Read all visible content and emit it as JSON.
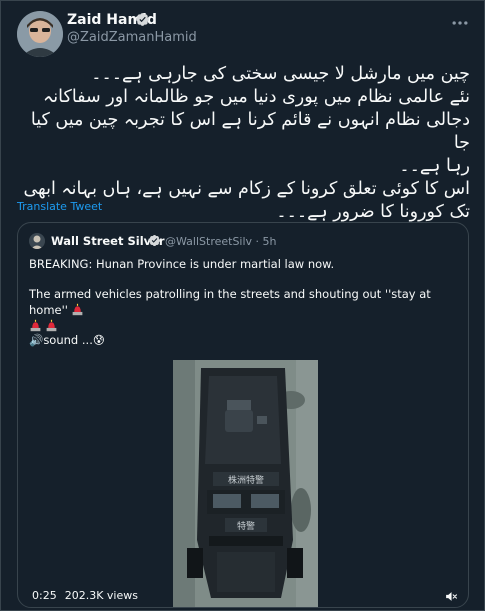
{
  "tweet": {
    "author_name": "Zaid Hamid",
    "author_handle": "@ZaidZamanHamid",
    "more_icon": "more-horizontal-icon",
    "text_lines": [
      "چین میں مارشل لا جیسی سختی کی جارہی ہے۔۔۔",
      "نئے عالمی نظام میں پوری دنیا میں جو ظالمانہ اور سفاکانہ",
      "دجالی نظام انہوں نے قائم کرنا ہے اس کا تجربہ چین میں کیا جا",
      "رہا ہے۔۔",
      "اس کا کوئی تعلق کرونا کے زکام سے نہیں ہے، ہاں بہانہ ابھی",
      "تک کورونا کا ضرور ہے۔۔۔"
    ],
    "translate_label": "Translate Tweet"
  },
  "quote": {
    "author_name": "Wall Street Silver",
    "author_handle": "@WallStreetSilv · 5h",
    "text_1": "BREAKING: Hunan Province is under martial law now.",
    "text_2": "The armed vehicles patrolling in the streets and shouting out ''stay at home''",
    "sound_text": "🔊sound ...😰",
    "video": {
      "time": "0:25",
      "views": "202.3K views",
      "vehicle_text_top": "株洲特警",
      "vehicle_text_front": "特警"
    }
  },
  "colors": {
    "background": "#15202b",
    "text": "#f7f9f9",
    "secondary_text": "#8b98a5",
    "accent": "#1d9bf0",
    "border": "#38444d"
  }
}
